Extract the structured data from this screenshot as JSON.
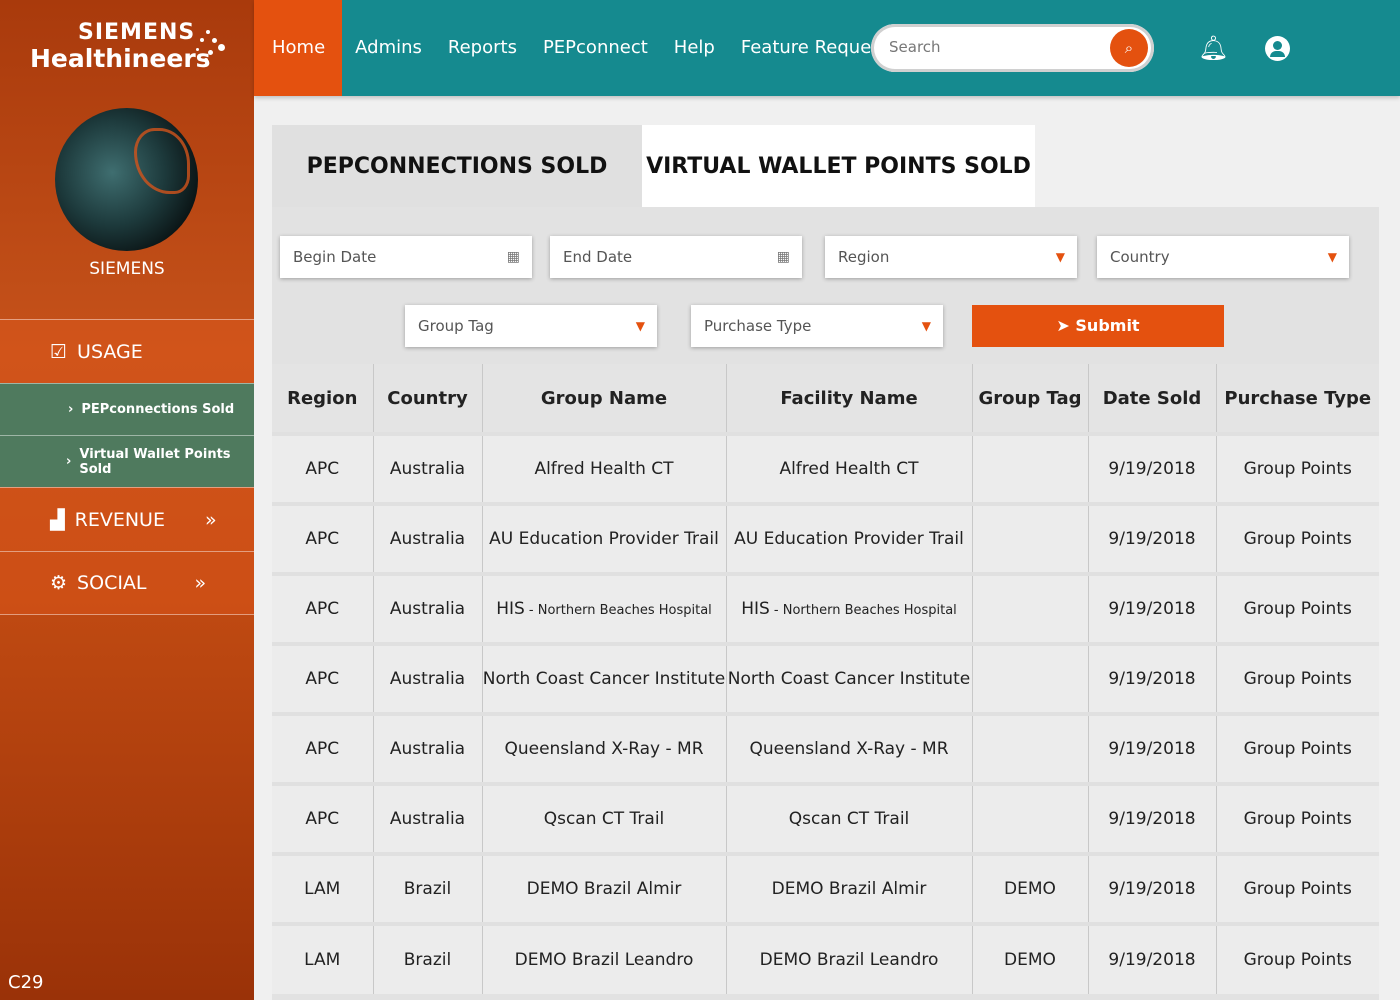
{
  "brand": {
    "line1": "SIEMENS",
    "line2": "Healthineers"
  },
  "sidebar": {
    "user_name": "SIEMENS",
    "usage": "USAGE",
    "sub_items": [
      "PEPconnections Sold",
      "Virtual Wallet Points Sold"
    ],
    "revenue": "REVENUE",
    "social": "SOCIAL",
    "chev": "»",
    "footer": "C29"
  },
  "topnav": {
    "items": [
      "Home",
      "Admins",
      "Reports",
      "PEPconnect",
      "Help",
      "Feature Request"
    ],
    "active": "Home",
    "search_placeholder": "Search"
  },
  "tabs": [
    "PEPCONNECTIONS SOLD",
    "VIRTUAL WALLET POINTS SOLD"
  ],
  "filters": {
    "begin_date": "Begin Date",
    "end_date": "End Date",
    "region": "Region",
    "country": "Country",
    "group_tag": "Group Tag",
    "purchase_type": "Purchase Type",
    "submit": "Submit"
  },
  "colors": {
    "accent": "#e4510f",
    "topbar": "#158a8f",
    "submenu": "#4f7a5e"
  },
  "table": {
    "headers": [
      "Region",
      "Country",
      "Group Name",
      "Facility Name",
      "Group Tag",
      "Date Sold",
      "Purchase Type"
    ],
    "rows": [
      [
        "APC",
        "Australia",
        "Alfred Health CT",
        "Alfred Health CT",
        "",
        "9/19/2018",
        "Group Points"
      ],
      [
        "APC",
        "Australia",
        "AU Education Provider Trail",
        "AU Education Provider Trail",
        "",
        "9/19/2018",
        "Group Points"
      ],
      [
        "APC",
        "Australia",
        "HIS",
        "HIS",
        "",
        "9/19/2018",
        "Group Points"
      ],
      [
        "APC",
        "Australia",
        "North Coast Cancer Institute",
        "North Coast Cancer Institute",
        "",
        "9/19/2018",
        "Group Points"
      ],
      [
        "APC",
        "Australia",
        "Queensland X-Ray - MR",
        "Queensland X-Ray - MR",
        "",
        "9/19/2018",
        "Group Points"
      ],
      [
        "APC",
        "Australia",
        "Qscan CT Trail",
        "Qscan CT Trail",
        "",
        "9/19/2018",
        "Group Points"
      ],
      [
        "LAM",
        "Brazil",
        "DEMO Brazil Almir",
        "DEMO Brazil Almir",
        "DEMO",
        "9/19/2018",
        "Group Points"
      ],
      [
        "LAM",
        "Brazil",
        "DEMO Brazil Leandro",
        "DEMO Brazil Leandro",
        "DEMO",
        "9/19/2018",
        "Group Points"
      ]
    ],
    "his_suffix": " - Northern Beaches Hospital"
  }
}
